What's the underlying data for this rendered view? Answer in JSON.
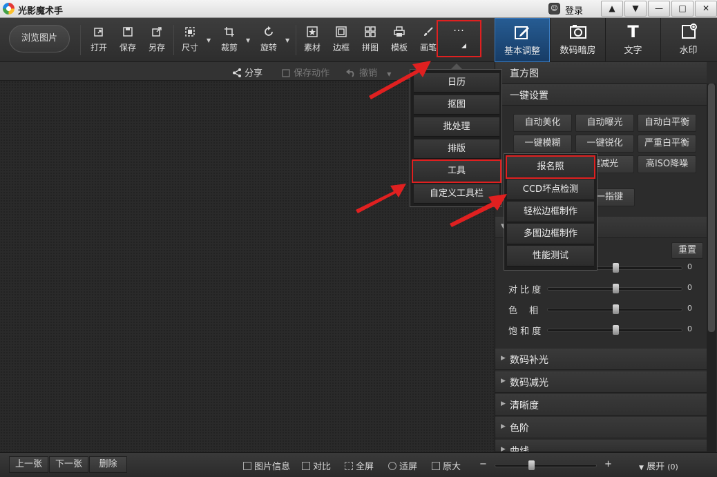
{
  "app": {
    "title": "光影魔术手",
    "login": "登录"
  },
  "window_controls": {
    "up": "▲",
    "down": "▼",
    "minimize": "—",
    "maximize": "□",
    "close": "✕"
  },
  "toolbar": {
    "browse": "浏览图片",
    "open": "打开",
    "save": "保存",
    "save_as": "另存",
    "size": "尺寸",
    "crop": "裁剪",
    "rotate": "旋转",
    "material": "素材",
    "border": "边框",
    "collage": "拼图",
    "template": "模板",
    "brush": "画笔",
    "more": "···"
  },
  "right_tabs": {
    "basic": "基本调整",
    "darkroom": "数码暗房",
    "text": "文字",
    "watermark": "水印",
    "text_glyph": "T"
  },
  "subbar": {
    "share": "分享",
    "save_action": "保存动作",
    "undo": "撤销"
  },
  "more_menu": [
    "日历",
    "抠图",
    "批处理",
    "排版",
    "工具",
    "自定义工具栏"
  ],
  "tools_menu": [
    "报名照",
    "CCD坏点检测",
    "轻松边框制作",
    "多图边框制作",
    "性能测试"
  ],
  "right_panel": {
    "histogram": "直方图",
    "one_click": "一键设置",
    "presets": [
      "自动美化",
      "自动曝光",
      "自动白平衡",
      "一键模糊",
      "一键锐化",
      "严重白平衡",
      "建减光",
      "高ISO降噪",
      "衡一指键"
    ],
    "reset": "重置",
    "sliders": [
      {
        "label": "",
        "value": 0,
        "level": 0.5
      },
      {
        "label": "对 比 度",
        "value": 0,
        "level": 0.5
      },
      {
        "label": "色　 相",
        "value": 0,
        "level": 0.5
      },
      {
        "label": "饱 和 度",
        "value": 0,
        "level": 0.5
      }
    ],
    "sections": [
      "数码补光",
      "数码减光",
      "清晰度",
      "色阶",
      "曲线"
    ]
  },
  "bottombar": {
    "prev": "上一张",
    "next": "下一张",
    "delete": "删除",
    "info": "图片信息",
    "compare": "对比",
    "fullscreen": "全屏",
    "fit": "适屏",
    "original": "原大",
    "minus": "−",
    "plus": "+",
    "expand": "展开",
    "expand_count": "(0)",
    "zoom_level": 0.35
  },
  "colors": {
    "highlight": "#e02020",
    "accent": "#265c93"
  }
}
